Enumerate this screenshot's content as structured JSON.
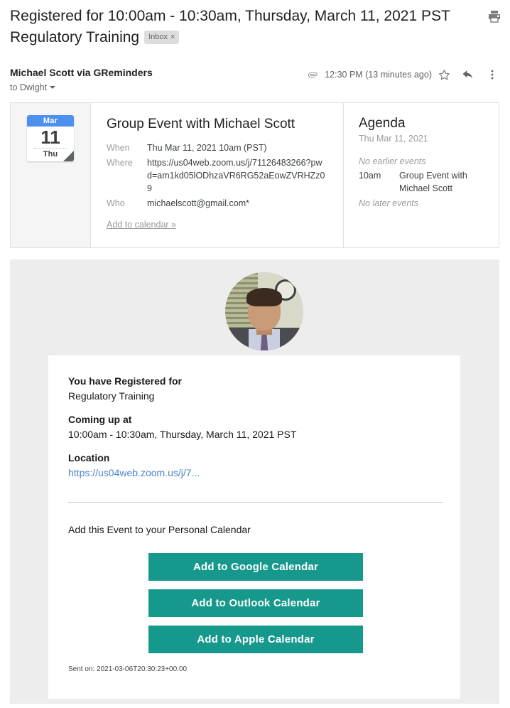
{
  "header": {
    "subject_line1": "Registered for 10:00am - 10:30am, Thursday, March 11, 2021 PST",
    "subject_line2": "Regulatory Training",
    "label_chip": "Inbox",
    "label_chip_close": "×",
    "print_icon": "print-icon"
  },
  "sender": {
    "name": "Michael Scott via GReminders",
    "to": "to Dwight",
    "timestamp": "12:30 PM (13 minutes ago)",
    "attachment_icon": "paperclip-icon",
    "star_icon": "star-icon",
    "reply_icon": "reply-icon",
    "more_icon": "more-vertical-icon"
  },
  "invite": {
    "date_chip": {
      "month": "Mar",
      "day": "11",
      "weekday": "Thu"
    },
    "title": "Group Event with Michael Scott",
    "rows": [
      {
        "key": "When",
        "value": "Thu Mar 11, 2021 10am (PST)"
      },
      {
        "key": "Where",
        "value": "https://us04web.zoom.us/j/71126483266?pwd=am1kd05lODhzaVR6RG52aEowZVRHZz09"
      },
      {
        "key": "Who",
        "value": "michaelscott@gmail.com*"
      }
    ],
    "add_to_calendar": "Add to calendar »"
  },
  "agenda": {
    "title": "Agenda",
    "date": "Thu Mar 11, 2021",
    "no_earlier": "No earlier events",
    "items": [
      {
        "time": "10am",
        "description": "Group Event with Michael Scott"
      }
    ],
    "no_later": "No later events"
  },
  "message": {
    "avatar_alt": "michael-scott-avatar",
    "registered_heading": "You have Registered for",
    "registered_value": "Regulatory Training",
    "coming_up_heading": "Coming up at",
    "coming_up_value": "10:00am - 10:30am, Thursday, March 11, 2021 PST",
    "location_heading": "Location",
    "location_link": "https://us04web.zoom.us/j/7...",
    "add_event_text": "Add this Event to your Personal Calendar",
    "buttons": [
      "Add to Google Calendar",
      "Add to Outlook Calendar",
      "Add to Apple Calendar"
    ],
    "sent_on": "Sent on: 2021-03-06T20:30:23+00:00"
  },
  "colors": {
    "teal_button": "#16998c",
    "link_blue": "#4a86c8",
    "chip_blue": "#4d90f0",
    "body_gray": "#ededed"
  }
}
